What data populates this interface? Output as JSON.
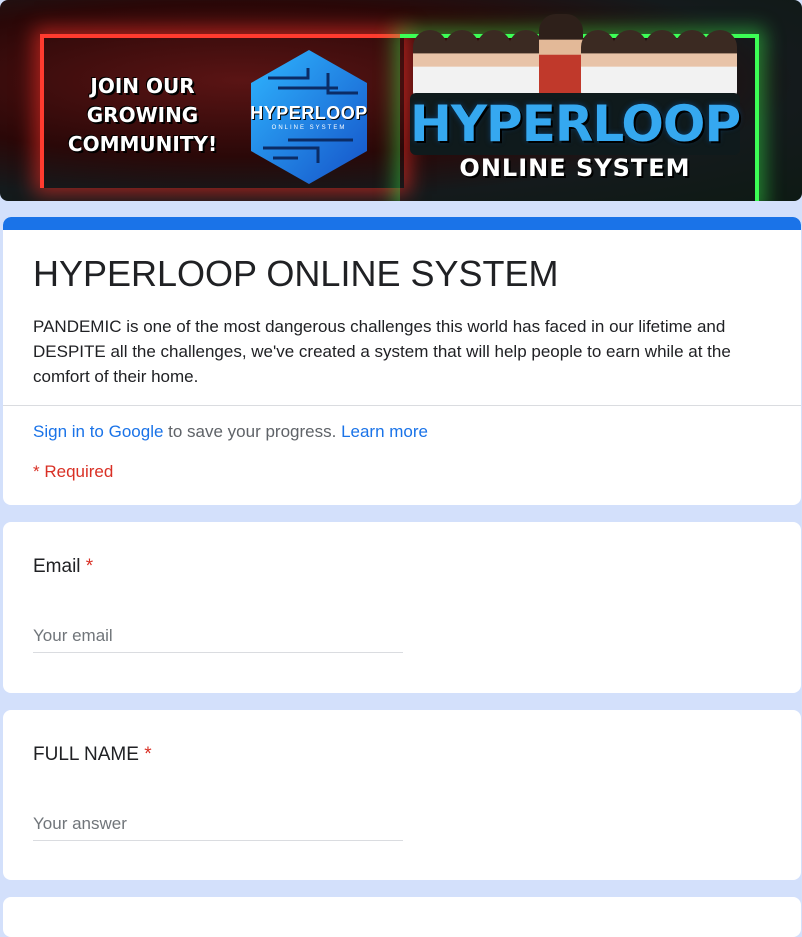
{
  "banner": {
    "join_text": "JOIN OUR GROWING COMMUNITY!",
    "logo_text": "HYPERLOOP",
    "logo_sub": "ONLINE SYSTEM",
    "title": "HYPERLOOP",
    "subtitle": "ONLINE SYSTEM",
    "colors": {
      "red_neon": "#ff3b2f",
      "green_neon": "#3cff55",
      "title_blue": "#35a8f0"
    }
  },
  "form": {
    "title": "HYPERLOOP ONLINE SYSTEM",
    "description": "PANDEMIC is one of the most dangerous challenges this world has faced in our lifetime and DESPITE all the challenges, we've created a system that will help people to earn while at the comfort of their home.",
    "signin_link": "Sign in to Google",
    "signin_text": " to save your progress. ",
    "learn_more": "Learn more",
    "required_note": "* Required",
    "accent_color": "#1a73e8"
  },
  "questions": [
    {
      "label": "Email",
      "required_mark": "*",
      "placeholder": "Your email"
    },
    {
      "label": "FULL NAME",
      "required_mark": "*",
      "placeholder": "Your answer"
    }
  ]
}
